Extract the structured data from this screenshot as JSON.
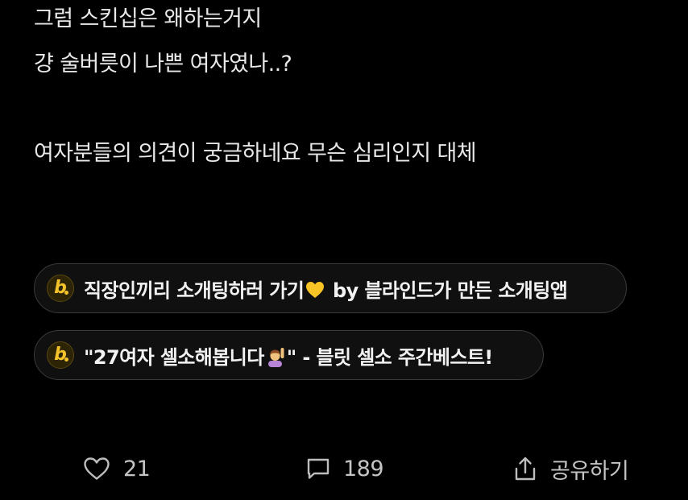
{
  "post": {
    "lines": [
      "그럼 스킨십은 왜하는거지",
      "걍 술버릇이 나쁜 여자였나..?",
      "여자분들의 의견이 궁금하네요 무슨 심리인지 대체"
    ]
  },
  "promos": [
    {
      "badge": "b",
      "text_before": "직장인끼리 소개팅하러 가기",
      "icon": "yellow-heart-icon",
      "text_after": " by 블라인드가 만든 소개팅앱"
    },
    {
      "badge": "b",
      "text_before": "\"27여자 셀소해봅니다",
      "icon": "person-raising-hand-icon",
      "text_after": "\" - 블릿 셀소 주간베스트!"
    }
  ],
  "actions": {
    "like_count": "21",
    "comment_count": "189",
    "share_label": "공유하기"
  },
  "colors": {
    "background": "#000000",
    "text": "#e8e8e8",
    "chip_border": "#3a3a3a",
    "brand_yellow": "#f4c22b",
    "action_gray": "#bdbdbd"
  }
}
